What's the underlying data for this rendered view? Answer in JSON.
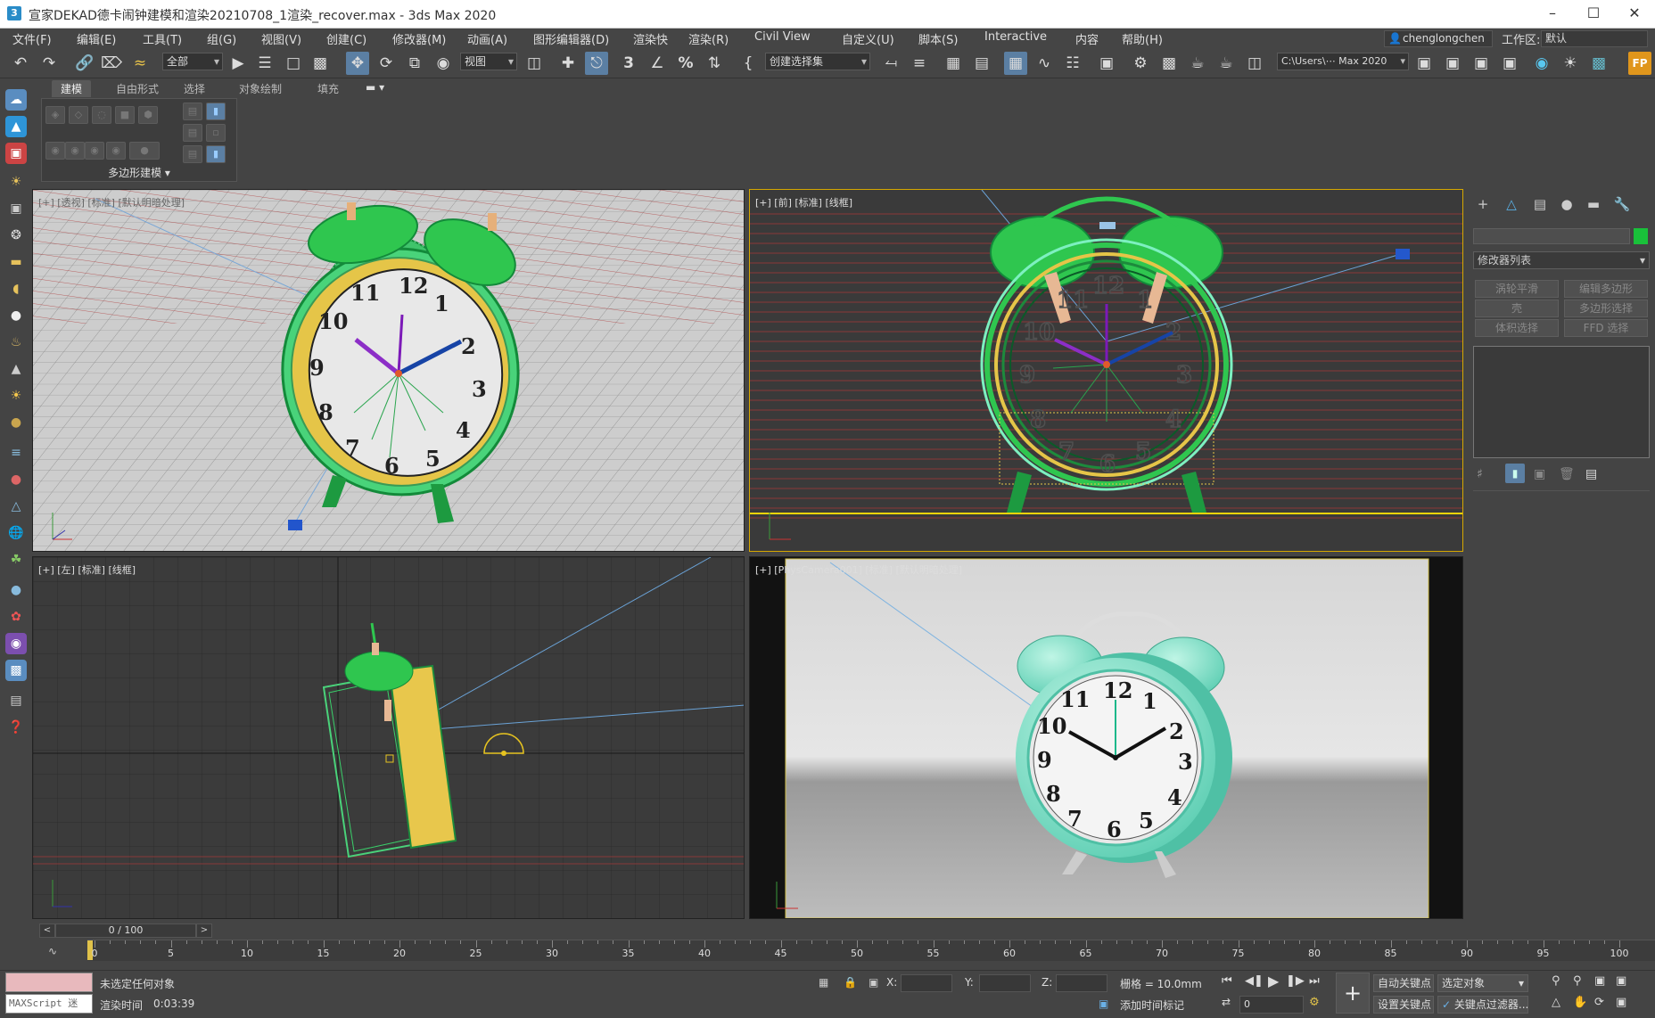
{
  "window": {
    "title": "宣家DEKAD德卡闹钟建模和渲染20210708_1渲染_recover.max - 3ds Max 2020",
    "app_icon": "3"
  },
  "menus": [
    "文件(F)",
    "编辑(E)",
    "工具(T)",
    "组(G)",
    "视图(V)",
    "创建(C)",
    "修改器(M)",
    "动画(A)",
    "图形编辑器(D)",
    "渲染快",
    "渲染(R)",
    "Civil View",
    "自定义(U)",
    "脚本(S)",
    "Interactive",
    "内容",
    "帮助(H)"
  ],
  "user": {
    "name": "chenglongchen"
  },
  "workspace": {
    "label": "工作区:",
    "value": "默认"
  },
  "toolbar": {
    "filter_dropdown": "全部",
    "refcoord_dropdown": "视图",
    "selection_set_dropdown": "创建选择集",
    "project_path": "C:\\Users\\⋯ Max 2020",
    "snap_3": "3",
    "percent": "%"
  },
  "ribbon": {
    "tabs": [
      "建模",
      "自由形式",
      "选择",
      "对象绘制",
      "填充"
    ],
    "active_tab": "建模",
    "panel_label": "多边形建模 ▾"
  },
  "viewports": [
    {
      "label": "[+] [透视] [标准] [默认明暗处理]"
    },
    {
      "label": "[+] [前] [标准] [线框]"
    },
    {
      "label": "[+] [左] [标准] [线框]"
    },
    {
      "label": "[+] [PhysCamera001] [标准] [默认明暗处理]"
    }
  ],
  "clock_numbers": [
    "12",
    "1",
    "2",
    "3",
    "4",
    "5",
    "6",
    "7",
    "8",
    "9",
    "10",
    "11"
  ],
  "command_panel": {
    "modifier_list": "修改器列表",
    "buttons": [
      "涡轮平滑",
      "编辑多边形",
      "壳",
      "多边形选择",
      "体积选择",
      "FFD 选择"
    ]
  },
  "timeline": {
    "frame_counter": "0 / 100",
    "ticks": [
      "0",
      "5",
      "10",
      "15",
      "20",
      "25",
      "30",
      "35",
      "40",
      "45",
      "50",
      "55",
      "60",
      "65",
      "70",
      "75",
      "80",
      "85",
      "90",
      "95",
      "100"
    ]
  },
  "status": {
    "maxscript": "MAXScript 迷",
    "selection": "未选定任何对象",
    "render_time_label": "渲染时间",
    "render_time": "0:03:39",
    "x_label": "X:",
    "y_label": "Y:",
    "z_label": "Z:",
    "grid": "栅格 = 10.0mm",
    "add_time_tag": "添加时间标记",
    "auto_key": "自动关键点",
    "selected_object": "选定对象",
    "set_key": "设置关键点",
    "key_filter": "关键点过滤器...",
    "frame": "0"
  }
}
